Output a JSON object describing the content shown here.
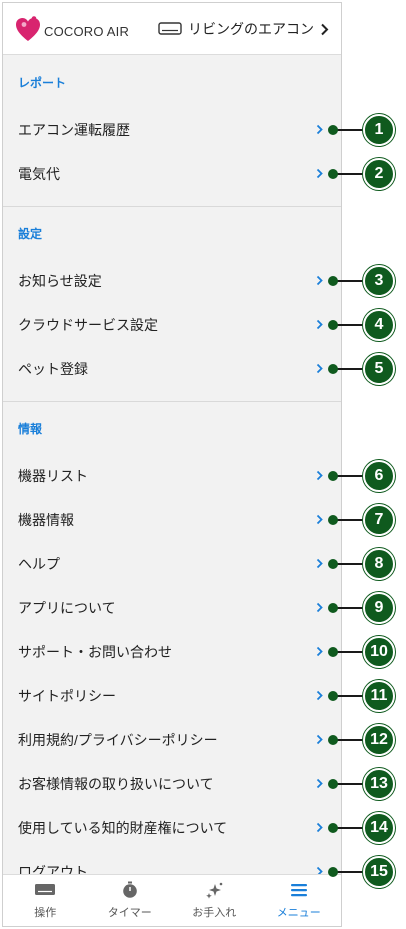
{
  "header": {
    "brand": "COCORO AIR",
    "device_name": "リビングのエアコン"
  },
  "menu": {
    "sections": [
      {
        "title": "レポート",
        "items": [
          "エアコン運転履歴",
          "電気代"
        ]
      },
      {
        "title": "設定",
        "items": [
          "お知らせ設定",
          "クラウドサービス設定",
          "ペット登録"
        ]
      },
      {
        "title": "情報",
        "items": [
          "機器リスト",
          "機器情報",
          "ヘルプ",
          "アプリについて",
          "サポート・お問い合わせ",
          "サイトポリシー",
          "利用規約/プライバシーポリシー",
          "お客様情報の取り扱いについて",
          "使用している知的財産権について",
          "ログアウト"
        ]
      }
    ]
  },
  "bottom_nav": {
    "items": [
      {
        "label": "操作",
        "icon": "remote-icon",
        "active": false
      },
      {
        "label": "タイマー",
        "icon": "timer-icon",
        "active": false
      },
      {
        "label": "お手入れ",
        "icon": "sparkle-icon",
        "active": false
      },
      {
        "label": "メニュー",
        "icon": "menu-icon",
        "active": true
      }
    ]
  },
  "callouts": [
    "1",
    "2",
    "3",
    "4",
    "5",
    "6",
    "7",
    "8",
    "9",
    "10",
    "11",
    "12",
    "13",
    "14",
    "15"
  ],
  "colors": {
    "accent": "#1a7fd9",
    "callout": "#0f5a1e",
    "logo": "#d8246f",
    "background": "#f2f2f2"
  }
}
